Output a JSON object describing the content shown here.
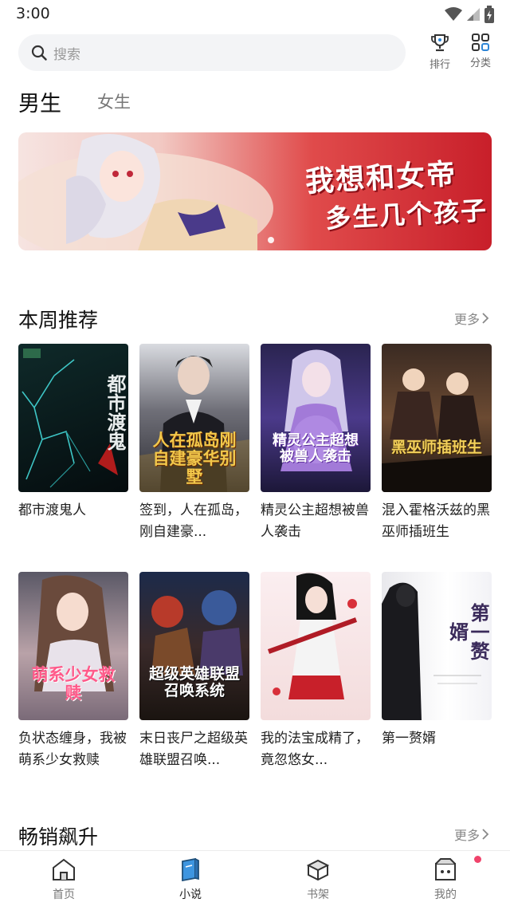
{
  "status": {
    "time": "3:00"
  },
  "search": {
    "placeholder": "搜索"
  },
  "top_actions": {
    "rank": "排行",
    "category": "分类"
  },
  "gender_tabs": {
    "male": "男生",
    "female": "女生"
  },
  "banner": {
    "title": "我想和女帝",
    "subtitle": "多生几个孩子",
    "slide_count": 1,
    "active_slide": 1
  },
  "weekly": {
    "title": "本周推荐",
    "more": "更多",
    "books": [
      {
        "name": "都市渡鬼人",
        "cover_text": "都市渡鬼"
      },
      {
        "name": "签到，人在孤岛，刚自建豪...",
        "cover_text": "人在孤岛刚自建豪华别墅"
      },
      {
        "name": "精灵公主超想被兽人袭击",
        "cover_text": "精灵公主超想被兽人袭击"
      },
      {
        "name": "混入霍格沃兹的黑巫师插班生",
        "cover_text": "黑巫师插班生"
      },
      {
        "name": "负状态缠身，我被萌系少女救赎",
        "cover_text": "萌系少女救赎"
      },
      {
        "name": "末日丧尸之超级英雄联盟召唤...",
        "cover_text": "超级英雄联盟召唤系统"
      },
      {
        "name": "我的法宝成精了，竟忽悠女...",
        "cover_text": ""
      },
      {
        "name": "第一赘婿",
        "cover_text": "第一赘婿"
      }
    ]
  },
  "bestseller": {
    "title": "畅销飙升",
    "more": "更多"
  },
  "bottom_nav": {
    "items": [
      {
        "label": "首页",
        "icon": "home-icon"
      },
      {
        "label": "小说",
        "icon": "book-icon"
      },
      {
        "label": "书架",
        "icon": "bookshelf-icon"
      },
      {
        "label": "我的",
        "icon": "profile-icon"
      }
    ],
    "active": "小说"
  },
  "colors": {
    "banner_red": "#c81f2a",
    "nav_active": "#2f86d6",
    "dot": "#f0436b"
  }
}
